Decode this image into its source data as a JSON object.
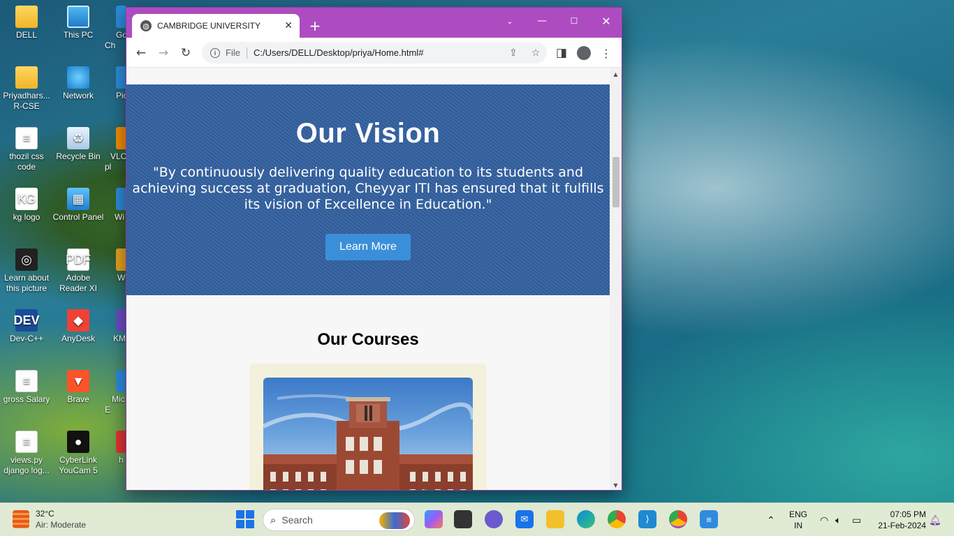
{
  "desktop_icons": [
    {
      "label": "DELL",
      "icon": "folder-icon"
    },
    {
      "label": "This PC",
      "icon": "computer-icon"
    },
    {
      "label": "Priyadhars... R-CSE",
      "icon": "folder-icon"
    },
    {
      "label": "Network",
      "icon": "network-icon"
    },
    {
      "label": "thozil css code",
      "icon": "document-icon"
    },
    {
      "label": "Recycle Bin",
      "icon": "recycle-bin-icon"
    },
    {
      "label": "kg logo",
      "icon": "image-icon"
    },
    {
      "label": "Control Panel",
      "icon": "control-panel-icon"
    },
    {
      "label": "Learn about this picture",
      "icon": "camera-icon"
    },
    {
      "label": "Adobe Reader XI",
      "icon": "pdf-icon"
    },
    {
      "label": "Dev-C++",
      "icon": "devcpp-icon"
    },
    {
      "label": "AnyDesk",
      "icon": "anydesk-icon"
    },
    {
      "label": "gross Salary",
      "icon": "document-icon"
    },
    {
      "label": "Brave",
      "icon": "brave-icon"
    },
    {
      "label": "views.py django log...",
      "icon": "document-icon"
    },
    {
      "label": "CyberLink YouCam 5",
      "icon": "webcam-icon"
    }
  ],
  "partial_icons": [
    "Go Ch",
    "Pic",
    "VLC pl",
    "Wi",
    "W",
    "KM",
    "Mic E",
    "h"
  ],
  "browser": {
    "tab_title": "CAMBRIDGE UNIVERSITY",
    "new_tab": "+",
    "address_scheme": "File",
    "address_url": "C:/Users/DELL/Desktop/priya/Home.html#"
  },
  "page": {
    "vision_heading": "Our Vision",
    "vision_quote": "\"By continuously delivering quality education to its students and achieving success at graduation, Cheyyar ITI has ensured that it fulfills its vision of Excellence in Education.\"",
    "learn_more": "Learn More",
    "courses_heading": "Our Courses"
  },
  "taskbar": {
    "weather_temp": "32°C",
    "weather_desc": "Air: Moderate",
    "search_placeholder": "Search",
    "lang_line1": "ENG",
    "lang_line2": "IN",
    "time": "07:05 PM",
    "date": "21-Feb-2024"
  },
  "colors": {
    "title_bar": "#ad4cc1",
    "vision_bg": "#2e5ea0",
    "learn_more_button": "#3b8fd9",
    "course_card": "#f3f1dc"
  }
}
